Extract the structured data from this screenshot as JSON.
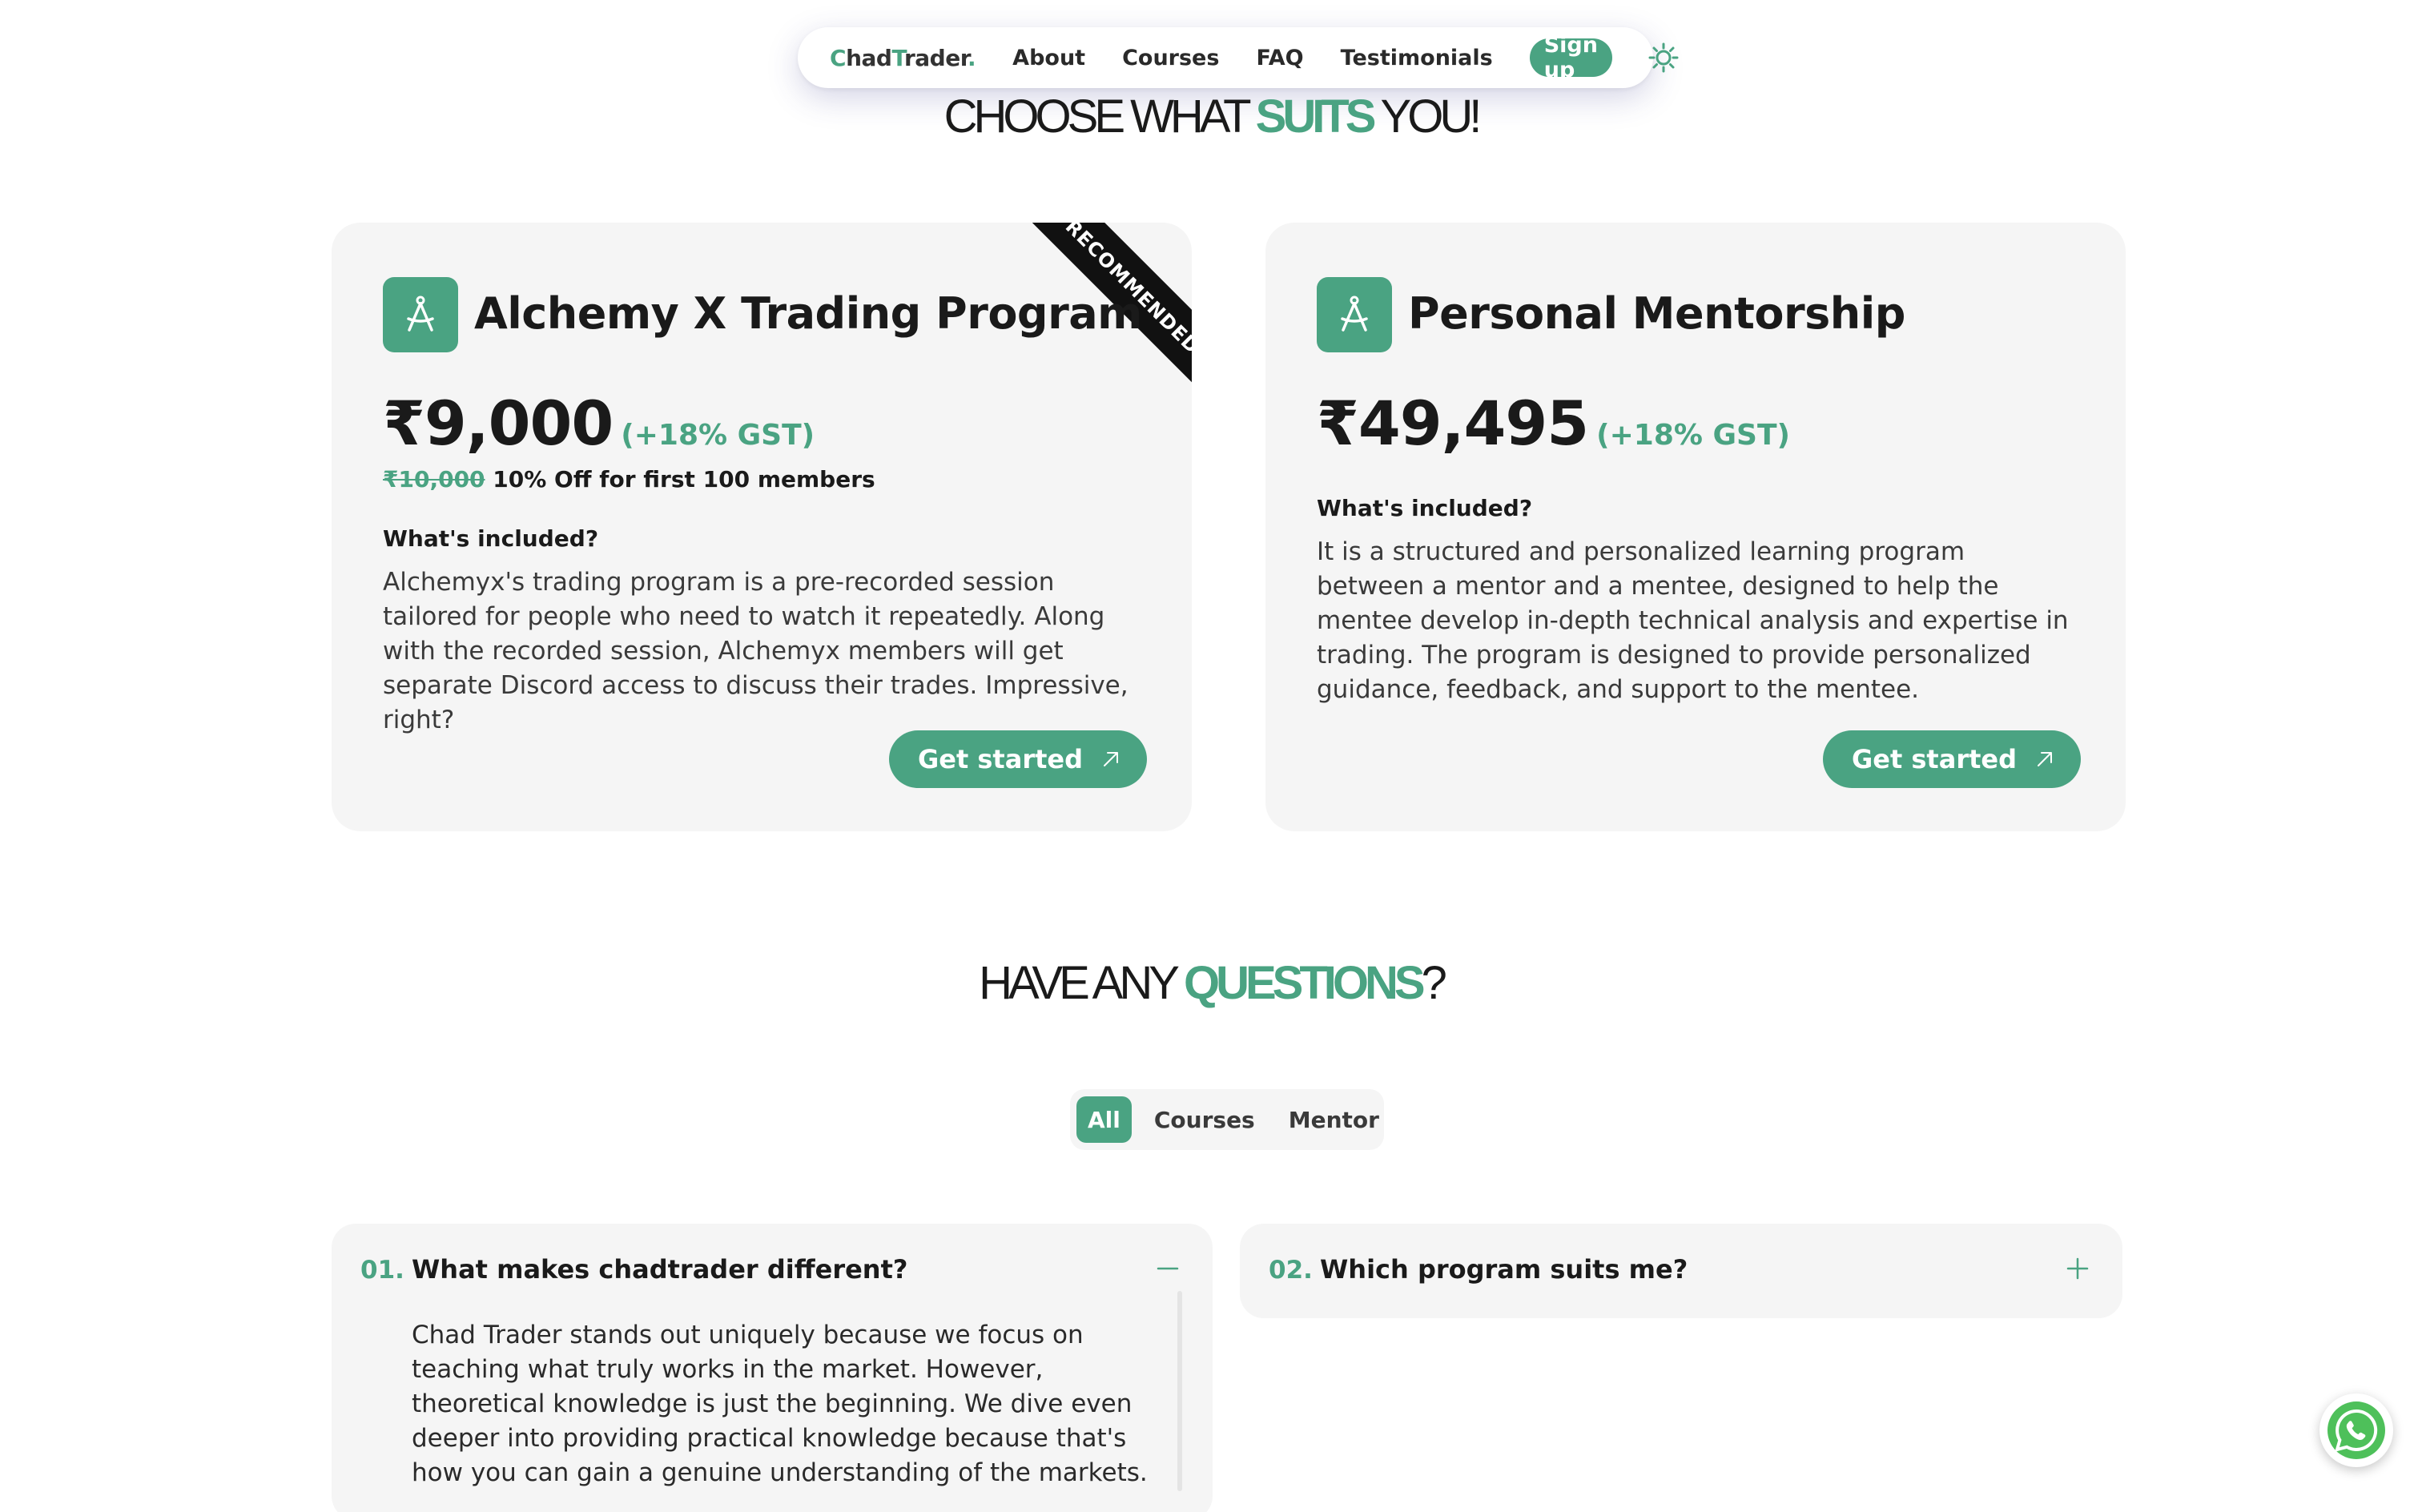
{
  "nav": {
    "logo": {
      "c": "C",
      "had": "had",
      "t": "T",
      "rader": "rader",
      "dot": "."
    },
    "links": [
      "About",
      "Courses",
      "FAQ",
      "Testimonials"
    ],
    "signup_label": "Sign up",
    "theme_icon": "sun-icon"
  },
  "pricing": {
    "heading": {
      "pre": "CHOOSE WHAT ",
      "accent": "SUITS",
      "post": " YOU!"
    },
    "cards": [
      {
        "title": "Alchemy X Trading Program",
        "icon": "compass-icon",
        "price": "₹9,000",
        "gst": "(+18% GST)",
        "original_price": "₹10,000",
        "discount_text": "10% Off for first 100 members",
        "ribbon": "RECOMMENDED",
        "included_label": "What's included?",
        "description": "Alchemyx's trading program is a pre-recorded session tailored for people who need to watch it repeatedly. Along with the recorded session, Alchemyx members will get separate Discord access to discuss their trades. Impressive, right?",
        "cta_label": "Get started"
      },
      {
        "title": "Personal Mentorship",
        "icon": "compass-icon",
        "price": "₹49,495",
        "gst": "(+18% GST)",
        "included_label": "What's included?",
        "description": "It is a structured and personalized learning program between a mentor and a mentee, designed to help the mentee develop in-depth technical analysis and expertise in trading. The program is designed to provide personalized guidance, feedback, and support to the mentee.",
        "cta_label": "Get started"
      }
    ]
  },
  "faq": {
    "heading": {
      "pre": "HAVE ANY ",
      "accent": "QUESTIONS",
      "post": "?"
    },
    "tabs": [
      "All",
      "Courses",
      "Mentor"
    ],
    "active_tab": "All",
    "items": [
      {
        "num": "01.",
        "question": "What makes chadtrader different?",
        "expanded": true,
        "answer": "Chad Trader stands out uniquely because we focus on teaching what truly works in the market. However, theoretical knowledge is just the beginning. We dive even deeper into providing practical knowledge because that's how you can gain a genuine understanding of the markets."
      },
      {
        "num": "02.",
        "question": "Which program suits me?",
        "expanded": false
      }
    ]
  },
  "colors": {
    "accent": "#4aa382",
    "card_bg": "#f5f5f5",
    "text": "#1a1a1a"
  },
  "floating": {
    "whatsapp_icon": "whatsapp-icon"
  }
}
